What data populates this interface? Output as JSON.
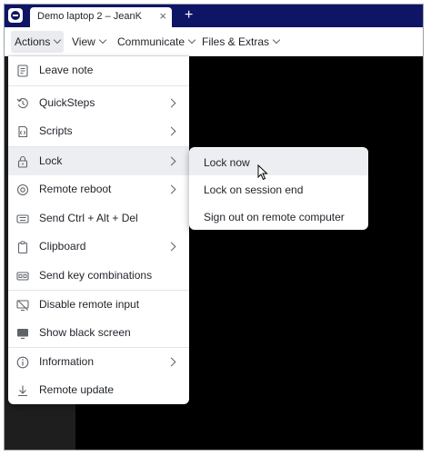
{
  "tab": {
    "title": "Demo laptop 2 – JeanK",
    "close_glyph": "×",
    "new_tab_glyph": "+"
  },
  "menubar": [
    {
      "label": "Actions",
      "active": true
    },
    {
      "label": "View"
    },
    {
      "label": "Communicate"
    },
    {
      "label": "Files & Extras"
    }
  ],
  "actions_menu": [
    {
      "label": "Leave note",
      "icon": "note-icon"
    },
    {
      "label": "QuickSteps",
      "icon": "quicksteps-icon",
      "submenu": true
    },
    {
      "label": "Scripts",
      "icon": "scripts-icon",
      "submenu": true
    },
    {
      "label": "Lock",
      "icon": "lock-icon",
      "submenu": true,
      "highlighted": true
    },
    {
      "label": "Remote reboot",
      "icon": "reboot-icon",
      "submenu": true
    },
    {
      "label": "Send Ctrl + Alt + Del",
      "icon": "keyboard-icon"
    },
    {
      "label": "Clipboard",
      "icon": "clipboard-icon",
      "submenu": true
    },
    {
      "label": "Send key combinations",
      "icon": "key-combo-icon"
    },
    {
      "label": "Disable remote input",
      "icon": "disable-input-icon"
    },
    {
      "label": "Show black screen",
      "icon": "monitor-icon"
    },
    {
      "label": "Information",
      "icon": "info-icon",
      "submenu": true
    },
    {
      "label": "Remote update",
      "icon": "download-icon"
    }
  ],
  "lock_submenu": [
    {
      "label": "Lock now",
      "highlighted": true
    },
    {
      "label": "Lock on session end"
    },
    {
      "label": "Sign out on remote computer"
    }
  ],
  "colors": {
    "titlebar": "#0f1565",
    "highlight": "#eceef1",
    "screen": "#000000"
  }
}
